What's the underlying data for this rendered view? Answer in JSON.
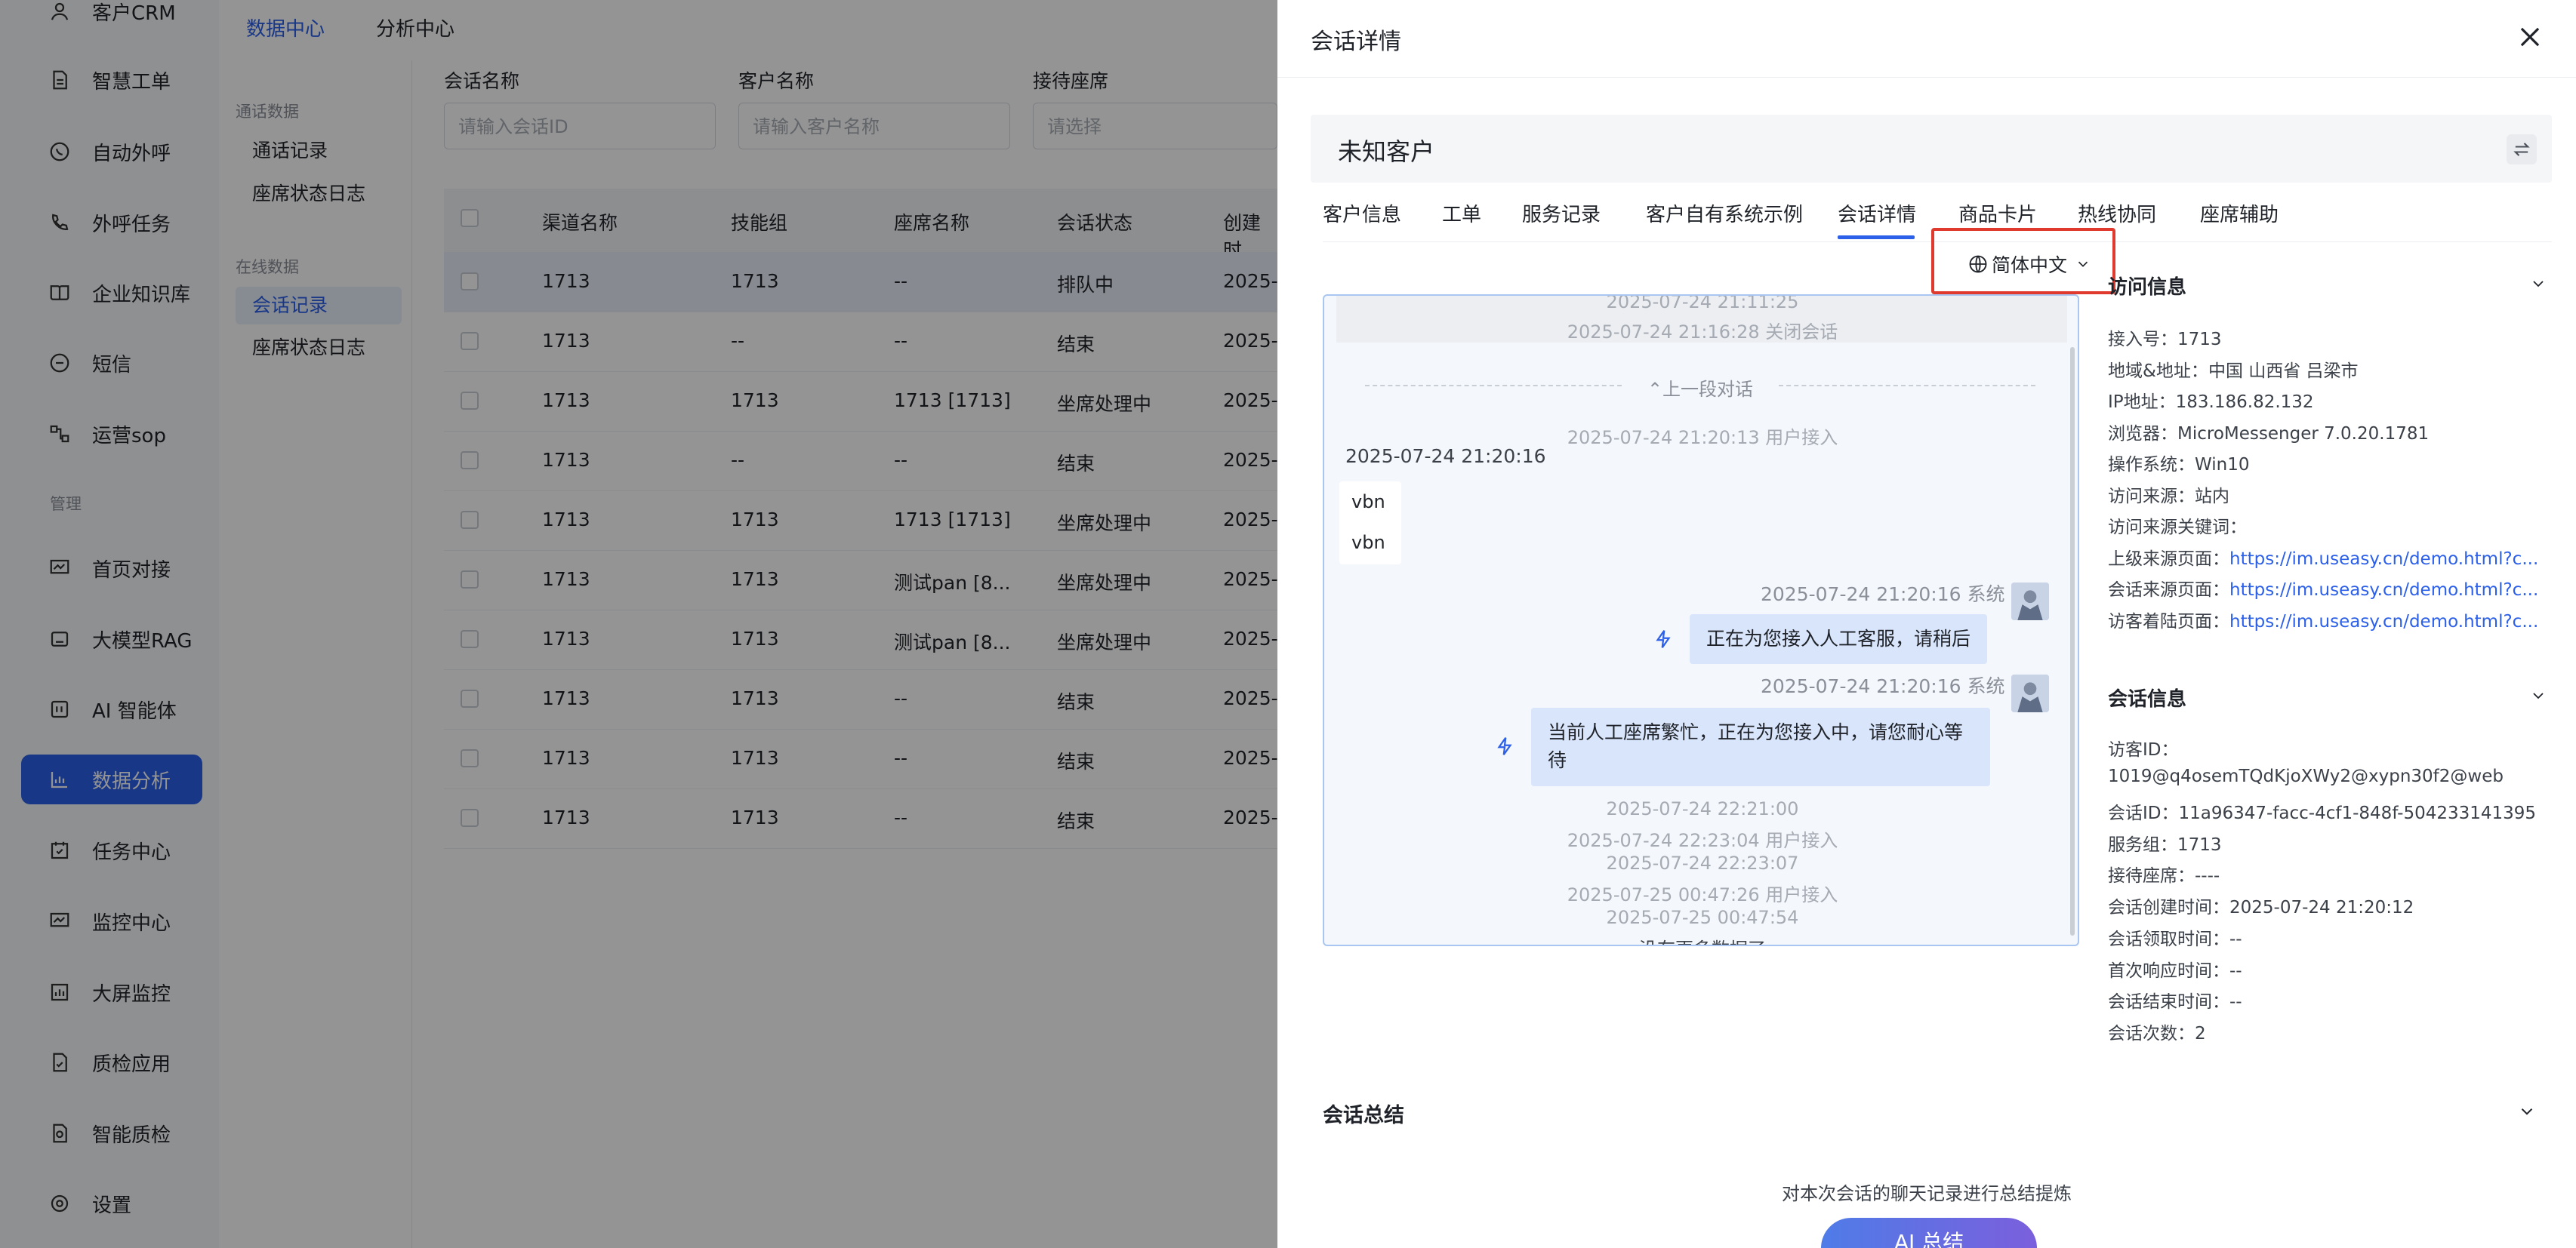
{
  "sidebar": {
    "items": [
      {
        "label": "客户CRM",
        "icon": "person-icon",
        "active": false
      },
      {
        "label": "智慧工单",
        "icon": "document-icon",
        "active": false
      },
      {
        "label": "自动外呼",
        "icon": "phone-chat-icon",
        "active": false
      },
      {
        "label": "外呼任务",
        "icon": "phone-task-icon",
        "active": false
      },
      {
        "label": "企业知识库",
        "icon": "book-icon",
        "active": false
      },
      {
        "label": "短信",
        "icon": "sms-icon",
        "active": false
      },
      {
        "label": "运营sop",
        "icon": "flow-icon",
        "active": false
      },
      {
        "label": "首页对接",
        "icon": "monitor-chart-icon",
        "active": false
      },
      {
        "label": "大模型RAG",
        "icon": "robot-icon",
        "active": false
      },
      {
        "label": "AI 智能体",
        "icon": "ai-agent-icon",
        "active": false
      },
      {
        "label": "数据分析",
        "icon": "bar-chart-icon",
        "active": true
      },
      {
        "label": "任务中心",
        "icon": "calendar-check-icon",
        "active": false
      },
      {
        "label": "监控中心",
        "icon": "monitor-chart-icon",
        "active": false
      },
      {
        "label": "大屏监控",
        "icon": "bar-chart-icon",
        "active": false
      },
      {
        "label": "质检应用",
        "icon": "doc-check-icon",
        "active": false
      },
      {
        "label": "智能质检",
        "icon": "doc-search-icon",
        "active": false
      },
      {
        "label": "设置",
        "icon": "gear-icon",
        "active": false
      }
    ],
    "section_manage": "管理"
  },
  "topbar": {
    "tabs": [
      "数据中心",
      "分析中心"
    ]
  },
  "subnav": {
    "group1": "通话数据",
    "group1_items": [
      "通话记录",
      "座席状态日志"
    ],
    "group2": "在线数据",
    "group2_items": [
      "会话记录",
      "座席状态日志"
    ]
  },
  "filters": {
    "session_label": "会话名称",
    "session_placeholder": "请输入会话ID",
    "customer_label": "客户名称",
    "customer_placeholder": "请输入客户名称",
    "agent_label": "接待座席",
    "agent_placeholder": "请选择"
  },
  "table": {
    "headers": [
      "渠道名称",
      "技能组",
      "座席名称",
      "会话状态",
      "创建时"
    ],
    "rows": [
      [
        "1713",
        "1713",
        "--",
        "排队中",
        "2025-"
      ],
      [
        "1713",
        "--",
        "--",
        "结束",
        "2025-"
      ],
      [
        "1713",
        "1713",
        "1713 [1713]",
        "坐席处理中",
        "2025-"
      ],
      [
        "1713",
        "--",
        "--",
        "结束",
        "2025-"
      ],
      [
        "1713",
        "1713",
        "1713 [1713]",
        "坐席处理中",
        "2025-"
      ],
      [
        "1713",
        "1713",
        "测试pan [8...",
        "坐席处理中",
        "2025-"
      ],
      [
        "1713",
        "1713",
        "测试pan [8...",
        "坐席处理中",
        "2025-"
      ],
      [
        "1713",
        "1713",
        "--",
        "结束",
        "2025-"
      ],
      [
        "1713",
        "1713",
        "--",
        "结束",
        "2025-"
      ],
      [
        "1713",
        "1713",
        "--",
        "结束",
        "2025-"
      ]
    ]
  },
  "drawer": {
    "title": "会话详情",
    "customer_name": "未知客户",
    "tabs": [
      "客户信息",
      "工单",
      "服务记录",
      "客户自有系统示例",
      "会话详情",
      "商品卡片",
      "热线协同",
      "座席辅助"
    ],
    "active_tab": "会话详情",
    "language": "简体中文",
    "chat": {
      "top_lines": [
        "2025-07-24 21:11:25",
        "2025-07-24 21:16:28 关闭会话"
      ],
      "prev_label": "上一段对话",
      "user_join": "2025-07-24 21:20:13 用户接入",
      "msg_time": "2025-07-24 21:20:16",
      "user_msgs": [
        "vbn",
        "vbn"
      ],
      "sys1_meta": "2025-07-24 21:20:16 系统",
      "sys1_text": "正在为您接入人工客服，请稍后",
      "sys2_meta": "2025-07-24 21:20:16 系统",
      "sys2_text": "当前人工座席繁忙，正在为您接入中，请您耐心等待",
      "bottom_lines": [
        "2025-07-24 22:21:00",
        "2025-07-24 22:23:04 用户接入",
        "2025-07-24 22:23:07",
        "2025-07-25 00:47:26 用户接入",
        "2025-07-25 00:47:54"
      ],
      "no_more": "没有更多数据了"
    },
    "visit": {
      "title": "访问信息",
      "items": [
        {
          "k": "接入号：",
          "v": "1713"
        },
        {
          "k": "地域&地址：",
          "v": "中国 山西省 吕梁市"
        },
        {
          "k": "IP地址：",
          "v": "183.186.82.132"
        },
        {
          "k": "浏览器：",
          "v": "MicroMessenger 7.0.20.1781"
        },
        {
          "k": "操作系统：",
          "v": "Win10"
        },
        {
          "k": "访问来源：",
          "v": "站内"
        },
        {
          "k": "访问来源关键词：",
          "v": ""
        },
        {
          "k": "上级来源页面：",
          "v": "https://im.useasy.cn/demo.html?c..."
        },
        {
          "k": "会话来源页面：",
          "v": "https://im.useasy.cn/demo.html?c..."
        },
        {
          "k": "访客着陆页面：",
          "v": "https://im.useasy.cn/demo.html?c..."
        }
      ]
    },
    "session": {
      "title": "会话信息",
      "visitor_id_label": "访客ID：",
      "visitor_id": "1019@q4osemTQdKjoXWy2@xypn30f2@web",
      "items": [
        {
          "k": "会话ID：",
          "v": "11a96347-facc-4cf1-848f-504233141395"
        },
        {
          "k": "服务组：",
          "v": "1713"
        },
        {
          "k": "接待座席：",
          "v": "----"
        },
        {
          "k": "会话创建时间：",
          "v": "2025-07-24 21:20:12"
        },
        {
          "k": "会话领取时间：",
          "v": "--"
        },
        {
          "k": "首次响应时间：",
          "v": "--"
        },
        {
          "k": "会话结束时间：",
          "v": "--"
        },
        {
          "k": "会话次数：",
          "v": "2"
        }
      ]
    },
    "summary": {
      "title": "会话总结",
      "hint": "对本次会话的聊天记录进行总结提炼",
      "button": "AI 总结"
    }
  },
  "colors": {
    "accent": "#2c60e8",
    "highlight_box": "#e03a2f",
    "bubble": "#d9e5fb"
  }
}
